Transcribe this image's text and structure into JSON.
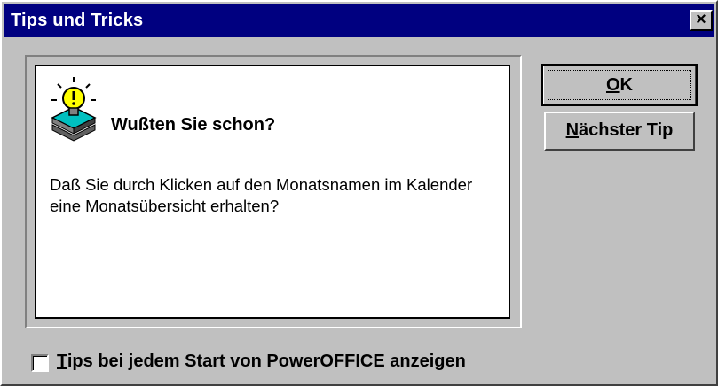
{
  "window": {
    "title": "Tips und Tricks",
    "close_label": "×"
  },
  "tip": {
    "heading": "Wußten Sie schon?",
    "message": "Daß Sie durch Klicken auf den Monatsnamen im Kalender eine Monatsübersicht erhalten?",
    "icon": "lightbulb-icon"
  },
  "buttons": {
    "ok": {
      "mnemonic": "O",
      "rest": "K"
    },
    "next": {
      "mnemonic": "N",
      "rest": "ächster Tip"
    }
  },
  "startup_checkbox": {
    "checked": false,
    "mnemonic": "T",
    "rest": "ips bei jedem Start von PowerOFFICE anzeigen"
  },
  "colors": {
    "titlebar": "#000080",
    "face": "#c0c0c0",
    "bulb": "#ffff00",
    "book": "#00c0c0"
  }
}
